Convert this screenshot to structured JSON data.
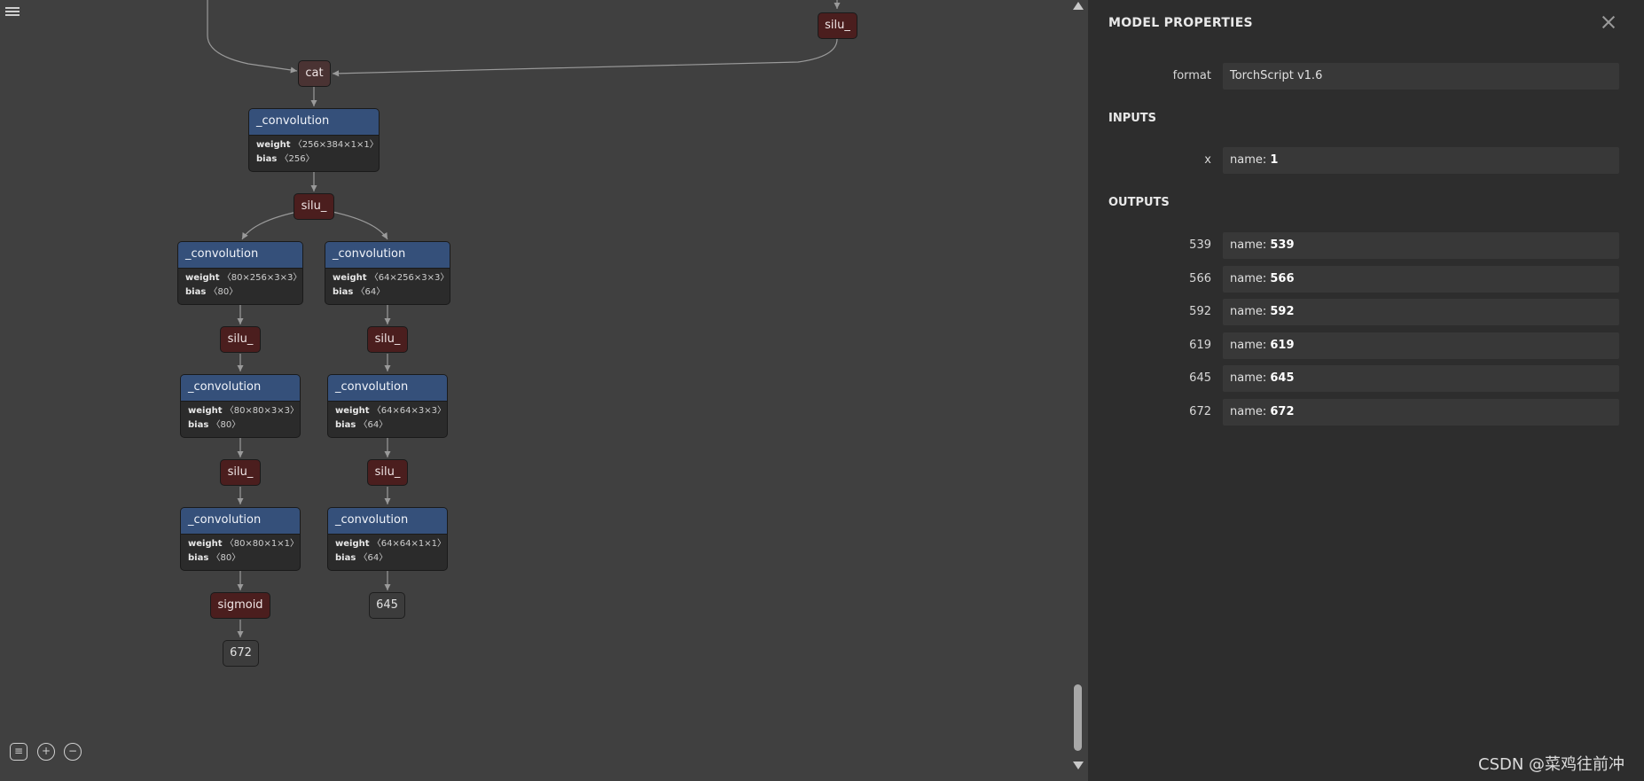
{
  "graph": {
    "nodes": {
      "silu_top": "silu_",
      "cat": "cat",
      "conv_main": {
        "title": "_convolution",
        "weight_label": "weight",
        "weight_shape": "〈256×384×1×1〉",
        "bias_label": "bias",
        "bias_shape": "〈256〉"
      },
      "silu_main": "silu_",
      "left_conv1": {
        "title": "_convolution",
        "weight_label": "weight",
        "weight_shape": "〈80×256×3×3〉",
        "bias_label": "bias",
        "bias_shape": "〈80〉"
      },
      "right_conv1": {
        "title": "_convolution",
        "weight_label": "weight",
        "weight_shape": "〈64×256×3×3〉",
        "bias_label": "bias",
        "bias_shape": "〈64〉"
      },
      "left_silu1": "silu_",
      "right_silu1": "silu_",
      "left_conv2": {
        "title": "_convolution",
        "weight_label": "weight",
        "weight_shape": "〈80×80×3×3〉",
        "bias_label": "bias",
        "bias_shape": "〈80〉"
      },
      "right_conv2": {
        "title": "_convolution",
        "weight_label": "weight",
        "weight_shape": "〈64×64×3×3〉",
        "bias_label": "bias",
        "bias_shape": "〈64〉"
      },
      "left_silu2": "silu_",
      "right_silu2": "silu_",
      "left_conv3": {
        "title": "_convolution",
        "weight_label": "weight",
        "weight_shape": "〈80×80×1×1〉",
        "bias_label": "bias",
        "bias_shape": "〈80〉"
      },
      "right_conv3": {
        "title": "_convolution",
        "weight_label": "weight",
        "weight_shape": "〈64×64×1×1〉",
        "bias_label": "bias",
        "bias_shape": "〈64〉"
      },
      "sigmoid": "sigmoid",
      "out_left": "672",
      "out_right": "645"
    },
    "menu_icon": "hamburger-icon",
    "tools": [
      "list-icon",
      "zoom-in-icon",
      "zoom-out-icon"
    ]
  },
  "panel": {
    "title": "MODEL PROPERTIES",
    "close_icon": "close-icon",
    "format": {
      "label": "format",
      "value": "TorchScript v1.6"
    },
    "inputs_heading": "INPUTS",
    "inputs": [
      {
        "label": "x",
        "name_prefix": "name:",
        "name": "1"
      }
    ],
    "outputs_heading": "OUTPUTS",
    "outputs": [
      {
        "label": "539",
        "name_prefix": "name:",
        "name": "539"
      },
      {
        "label": "566",
        "name_prefix": "name:",
        "name": "566"
      },
      {
        "label": "592",
        "name_prefix": "name:",
        "name": "592"
      },
      {
        "label": "619",
        "name_prefix": "name:",
        "name": "619"
      },
      {
        "label": "645",
        "name_prefix": "name:",
        "name": "645"
      },
      {
        "label": "672",
        "name_prefix": "name:",
        "name": "672"
      }
    ]
  },
  "watermark": "CSDN @菜鸡往前冲"
}
